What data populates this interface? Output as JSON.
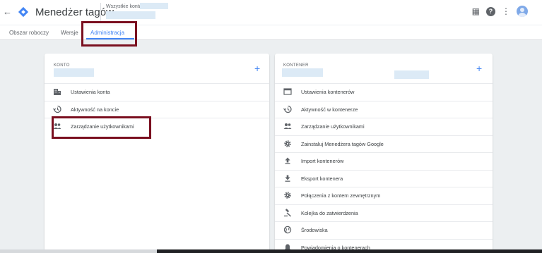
{
  "header": {
    "app_title": "Menedżer tagów",
    "breadcrumb": "Wszystkie konta >",
    "back_icon": "arrow-back-icon",
    "logo_icon": "gtm-logo-icon"
  },
  "tabs": [
    {
      "label": "Obszar roboczy",
      "active": false
    },
    {
      "label": "Wersje",
      "active": false
    },
    {
      "label": "Administracja",
      "active": true
    }
  ],
  "account_card": {
    "heading": "KONTO",
    "items": [
      {
        "label": "Ustawienia konta",
        "icon": "building-icon"
      },
      {
        "label": "Aktywność na koncie",
        "icon": "history-icon"
      },
      {
        "label": "Zarządzanie użytkownikami",
        "icon": "people-icon"
      }
    ]
  },
  "container_card": {
    "heading": "KONTENER",
    "items": [
      {
        "label": "Ustawienia kontenerów",
        "icon": "browser-window-icon"
      },
      {
        "label": "Aktywność w kontenerze",
        "icon": "history-icon"
      },
      {
        "label": "Zarządzanie użytkownikami",
        "icon": "people-icon"
      },
      {
        "label": "Zainstaluj Menedżera tagów Google",
        "icon": "gear-icon"
      },
      {
        "label": "Import kontenerów",
        "icon": "upload-icon"
      },
      {
        "label": "Eksport kontenera",
        "icon": "download-icon"
      },
      {
        "label": "Połączenia z kontem zewnętrznym",
        "icon": "gear-icon"
      },
      {
        "label": "Kolejka do zatwierdzenia",
        "icon": "gavel-icon"
      },
      {
        "label": "Środowiska",
        "icon": "globe-icon"
      },
      {
        "label": "Powiadomienia o kontenerach",
        "icon": "bell-icon"
      }
    ]
  },
  "colors": {
    "accent": "#4285f4",
    "highlight": "#7a0f1f",
    "redaction": "#dceaf6",
    "page_bg": "#eceff1"
  }
}
